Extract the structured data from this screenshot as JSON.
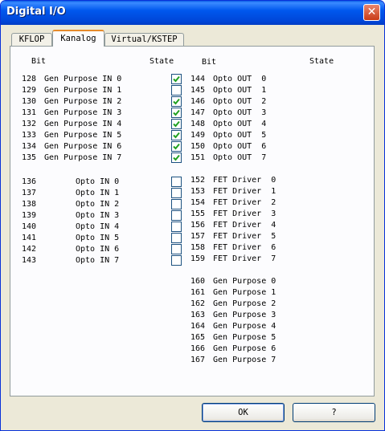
{
  "window": {
    "title": "Digital I/O",
    "close_symbol": "✕"
  },
  "tabs": [
    {
      "label": "KFLOP",
      "active": false
    },
    {
      "label": "Kanalog",
      "active": true
    },
    {
      "label": "Virtual/KSTEP",
      "active": false
    }
  ],
  "headers": {
    "bit": "Bit",
    "state": "State"
  },
  "left_groups": [
    {
      "rows": [
        {
          "bit": "128",
          "label": "Gen Purpose IN 0",
          "checked": true
        },
        {
          "bit": "129",
          "label": "Gen Purpose IN 1",
          "checked": false
        },
        {
          "bit": "130",
          "label": "Gen Purpose IN 2",
          "checked": true
        },
        {
          "bit": "131",
          "label": "Gen Purpose IN 3",
          "checked": true
        },
        {
          "bit": "132",
          "label": "Gen Purpose IN 4",
          "checked": true
        },
        {
          "bit": "133",
          "label": "Gen Purpose IN 5",
          "checked": true
        },
        {
          "bit": "134",
          "label": "Gen Purpose IN 6",
          "checked": true
        },
        {
          "bit": "135",
          "label": "Gen Purpose IN 7",
          "checked": true
        }
      ]
    },
    {
      "rows": [
        {
          "bit": "136",
          "label": "Opto IN 0",
          "checked": false
        },
        {
          "bit": "137",
          "label": "Opto IN 1",
          "checked": false
        },
        {
          "bit": "138",
          "label": "Opto IN 2",
          "checked": false
        },
        {
          "bit": "139",
          "label": "Opto IN 3",
          "checked": false
        },
        {
          "bit": "140",
          "label": "Opto IN 4",
          "checked": false
        },
        {
          "bit": "141",
          "label": "Opto IN 5",
          "checked": false
        },
        {
          "bit": "142",
          "label": "Opto IN 6",
          "checked": false
        },
        {
          "bit": "143",
          "label": "Opto IN 7",
          "checked": false
        }
      ]
    }
  ],
  "right_groups": [
    {
      "rows": [
        {
          "bit": "144",
          "label": "Opto OUT  0",
          "checked": false
        },
        {
          "bit": "145",
          "label": "Opto OUT  1",
          "checked": false
        },
        {
          "bit": "146",
          "label": "Opto OUT  2",
          "checked": false
        },
        {
          "bit": "147",
          "label": "Opto OUT  3",
          "checked": false
        },
        {
          "bit": "148",
          "label": "Opto OUT  4",
          "checked": false
        },
        {
          "bit": "149",
          "label": "Opto OUT  5",
          "checked": false
        },
        {
          "bit": "150",
          "label": "Opto OUT  6",
          "checked": false
        },
        {
          "bit": "151",
          "label": "Opto OUT  7",
          "checked": false
        }
      ]
    },
    {
      "rows": [
        {
          "bit": "152",
          "label": "FET Driver  0",
          "checked": false
        },
        {
          "bit": "153",
          "label": "FET Driver  1",
          "checked": false
        },
        {
          "bit": "154",
          "label": "FET Driver  2",
          "checked": false
        },
        {
          "bit": "155",
          "label": "FET Driver  3",
          "checked": false
        },
        {
          "bit": "156",
          "label": "FET Driver  4",
          "checked": false
        },
        {
          "bit": "157",
          "label": "FET Driver  5",
          "checked": false
        },
        {
          "bit": "158",
          "label": "FET Driver  6",
          "checked": false
        },
        {
          "bit": "159",
          "label": "FET Driver  7",
          "checked": false
        }
      ]
    },
    {
      "rows": [
        {
          "bit": "160",
          "label": "Gen Purpose 0",
          "checked": false
        },
        {
          "bit": "161",
          "label": "Gen Purpose 1",
          "checked": false
        },
        {
          "bit": "162",
          "label": "Gen Purpose 2",
          "checked": false
        },
        {
          "bit": "163",
          "label": "Gen Purpose 3",
          "checked": false
        },
        {
          "bit": "164",
          "label": "Gen Purpose 4",
          "checked": false
        },
        {
          "bit": "165",
          "label": "Gen Purpose 5",
          "checked": false
        },
        {
          "bit": "166",
          "label": "Gen Purpose 6",
          "checked": false
        },
        {
          "bit": "167",
          "label": "Gen Purpose 7",
          "checked": false
        }
      ]
    }
  ],
  "buttons": {
    "ok": "OK",
    "help": "?"
  },
  "colors": {
    "titlebar": "#0054e3",
    "check": "#21a121",
    "tab_highlight": "#e68b2c"
  }
}
